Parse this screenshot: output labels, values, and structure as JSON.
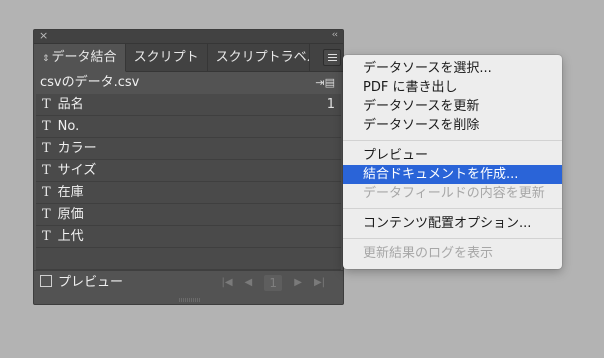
{
  "panel": {
    "close_glyph": "×",
    "collapse_glyph": "‹‹",
    "tabs": [
      {
        "label": "データ結合",
        "active": true
      },
      {
        "label": "スクリプト",
        "active": false
      },
      {
        "label": "スクリプトラベル",
        "active": false
      }
    ],
    "tab_arrows": "⇕",
    "menu_button_icon": "hamburger-menu-icon",
    "data_source": "csvのデータ.csv",
    "field_type_glyph": "T",
    "fields": [
      {
        "name": "品名",
        "value": "1"
      },
      {
        "name": "No.",
        "value": ""
      },
      {
        "name": "カラー",
        "value": ""
      },
      {
        "name": "サイズ",
        "value": ""
      },
      {
        "name": "在庫",
        "value": ""
      },
      {
        "name": "原価",
        "value": ""
      },
      {
        "name": "上代",
        "value": ""
      }
    ],
    "preview_label": "プレビュー",
    "preview_checked": false,
    "record_number": "1"
  },
  "menu": {
    "groups": [
      [
        {
          "label": "データソースを選択...",
          "disabled": false,
          "highlighted": false
        },
        {
          "label": "PDF に書き出し",
          "disabled": false,
          "highlighted": false
        },
        {
          "label": "データソースを更新",
          "disabled": false,
          "highlighted": false
        },
        {
          "label": "データソースを削除",
          "disabled": false,
          "highlighted": false
        }
      ],
      [
        {
          "label": "プレビュー",
          "disabled": false,
          "highlighted": false
        },
        {
          "label": "結合ドキュメントを作成...",
          "disabled": false,
          "highlighted": true
        },
        {
          "label": "データフィールドの内容を更新",
          "disabled": true,
          "highlighted": false
        }
      ],
      [
        {
          "label": "コンテンツ配置オプション...",
          "disabled": false,
          "highlighted": false
        }
      ],
      [
        {
          "label": "更新結果のログを表示",
          "disabled": true,
          "highlighted": false
        }
      ]
    ]
  },
  "colors": {
    "background": "#b3b3b3",
    "panel": "#535353",
    "highlight": "#2a64d8"
  }
}
